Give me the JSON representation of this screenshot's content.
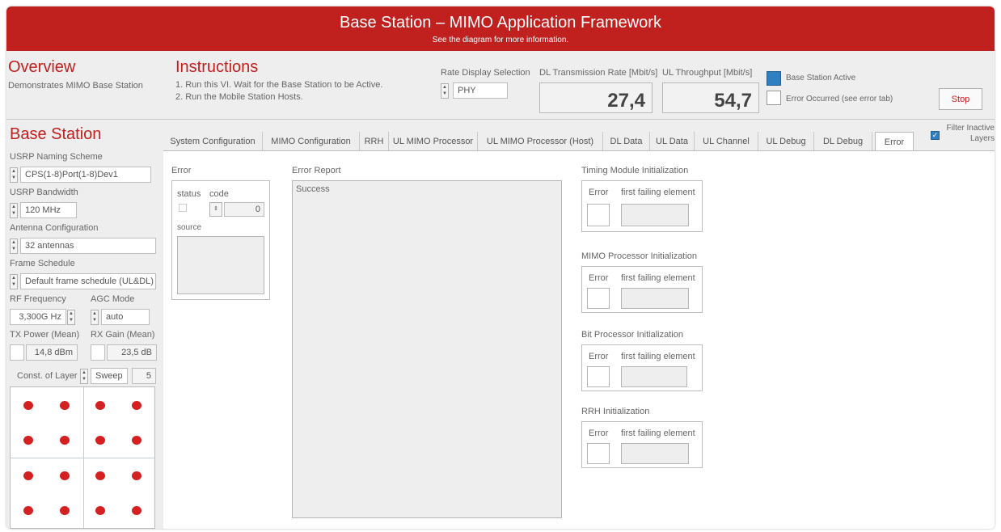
{
  "title": "Base Station – MIMO Application Framework",
  "subtitle": "See the diagram for more information.",
  "overview": {
    "heading": "Overview",
    "text": "Demonstrates MIMO Base Station"
  },
  "instructions": {
    "heading": "Instructions",
    "line1": "1. Run this VI. Wait for the Base Station to be Active.",
    "line2": "2. Run the Mobile Station Hosts."
  },
  "rate_display": {
    "label": "Rate Display Selection",
    "value": "PHY"
  },
  "dl_rate": {
    "label": "DL Transmission Rate [Mbit/s]",
    "value": "27,4"
  },
  "ul_throughput": {
    "label": "UL Throughput [Mbit/s]",
    "value": "54,7"
  },
  "status": {
    "active_label": "Base Station Active",
    "active_color": "#2f7fc1",
    "error_label": "Error Occurred (see error tab)"
  },
  "stop_label": "Stop",
  "filter": {
    "label": "Filter Inactive Layers",
    "checked": true
  },
  "base_station": {
    "heading": "Base Station",
    "naming_label": "USRP Naming Scheme",
    "naming_value": "CPS(1-8)Port(1-8)Dev1",
    "bandwidth_label": "USRP Bandwidth",
    "bandwidth_value": "120 MHz",
    "antenna_label": "Antenna Configuration",
    "antenna_value": "32 antennas",
    "frame_label": "Frame Schedule",
    "frame_value": "Default frame schedule (UL&DL)",
    "rf_label": "RF Frequency",
    "rf_value": "3,300G Hz",
    "agc_label": "AGC Mode",
    "agc_value": "auto",
    "tx_label": "TX Power (Mean)",
    "tx_value": "14,8 dBm",
    "rx_label": "RX Gain (Mean)",
    "rx_value": "23,5 dB",
    "const_label": "Const. of Layer",
    "const_mode": "Sweep",
    "const_value": "5"
  },
  "tabs": [
    "System Configuration",
    "MIMO Configuration",
    "RRH",
    "UL MIMO Processor",
    "UL MIMO Processor (Host)",
    "DL Data",
    "UL Data",
    "UL Channel",
    "UL Debug",
    "DL Debug",
    "Error"
  ],
  "active_tab": "Error",
  "error_panel": {
    "error_heading": "Error",
    "status_label": "status",
    "code_label": "code",
    "code_value": "0",
    "source_label": "source",
    "report_heading": "Error Report",
    "report_text": "Success",
    "init_sections": [
      {
        "title": "Timing Module Initialization",
        "error_label": "Error",
        "element_label": "first failing element"
      },
      {
        "title": "MIMO Processor Initialization",
        "error_label": "Error",
        "element_label": "first failing element"
      },
      {
        "title": "Bit Processor Initialization",
        "error_label": "Error",
        "element_label": "first failing element"
      },
      {
        "title": "RRH Initialization",
        "error_label": "Error",
        "element_label": "first failing element"
      }
    ]
  },
  "constellation": {
    "dot_color": "#d42020",
    "points": [
      [
        -3,
        3
      ],
      [
        -1,
        3
      ],
      [
        1,
        3
      ],
      [
        3,
        3
      ],
      [
        -3,
        1
      ],
      [
        -1,
        1
      ],
      [
        1,
        1
      ],
      [
        3,
        1
      ],
      [
        -3,
        -1
      ],
      [
        -1,
        -1
      ],
      [
        1,
        -1
      ],
      [
        3,
        -1
      ],
      [
        -3,
        -3
      ],
      [
        -1,
        -3
      ],
      [
        1,
        -3
      ],
      [
        3,
        -3
      ]
    ]
  }
}
